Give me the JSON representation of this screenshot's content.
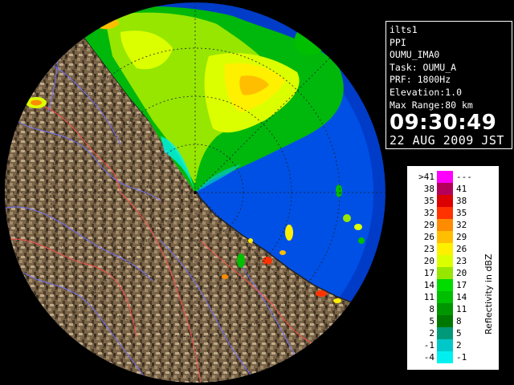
{
  "info": {
    "station": "ilts1",
    "scan_type": "PPI",
    "product": "OUMU_IMA0",
    "task": "Task: OUMU_A",
    "prf": "PRF: 1800Hz",
    "elevation": "Elevation:1.0",
    "max_range": "Max Range:80 km",
    "time": "09:30:49",
    "date": "22 AUG 2009 JST"
  },
  "legend": {
    "unit": "Reflectivity in dBZ",
    "rows": [
      {
        "lo": ">41",
        "hi": "---",
        "color": "#ff00ff"
      },
      {
        "lo": "38",
        "hi": "41",
        "color": "#b4005a"
      },
      {
        "lo": "35",
        "hi": "38",
        "color": "#dc0000"
      },
      {
        "lo": "32",
        "hi": "35",
        "color": "#ff3200"
      },
      {
        "lo": "29",
        "hi": "32",
        "color": "#ff8c00"
      },
      {
        "lo": "26",
        "hi": "29",
        "color": "#ffbe00"
      },
      {
        "lo": "23",
        "hi": "26",
        "color": "#fff000"
      },
      {
        "lo": "20",
        "hi": "23",
        "color": "#dcff00"
      },
      {
        "lo": "17",
        "hi": "20",
        "color": "#96e600"
      },
      {
        "lo": "14",
        "hi": "17",
        "color": "#00dc00"
      },
      {
        "lo": "11",
        "hi": "14",
        "color": "#00be00"
      },
      {
        "lo": "8",
        "hi": "11",
        "color": "#009600"
      },
      {
        "lo": "5",
        "hi": "8",
        "color": "#007800"
      },
      {
        "lo": "2",
        "hi": "5",
        "color": "#009a78"
      },
      {
        "lo": "-1",
        "hi": "2",
        "color": "#00c8c8"
      },
      {
        "lo": "-4",
        "hi": "-1",
        "color": "#00f0f0"
      }
    ]
  },
  "map": {
    "sea_color": "#0050e6",
    "outer_ring_color": "#003cc8",
    "land_color": "#7a6448",
    "river_color": "#7070ff",
    "boundary_color": "#ff5050"
  }
}
